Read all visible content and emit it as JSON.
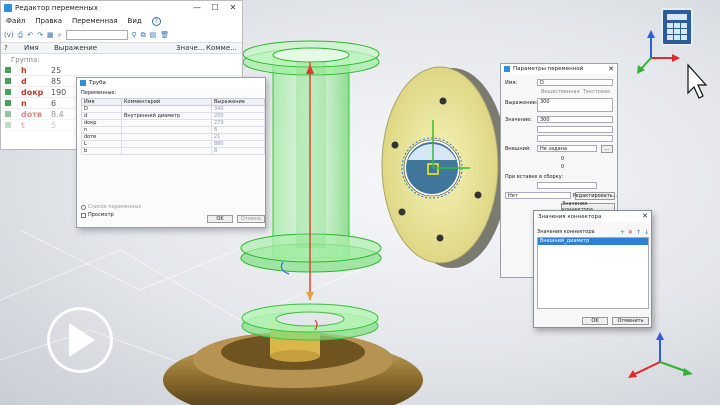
{
  "editor": {
    "title": "Редактор переменных",
    "menu": [
      "Файл",
      "Правка",
      "Переменная",
      "Вид"
    ],
    "help": "?",
    "toolbar_prefix": "(v)",
    "columns": [
      "Имя",
      "Выражение",
      "Значе...",
      "Комме..."
    ],
    "group_label": "Группа:",
    "rows": [
      {
        "name": "h",
        "value": "25"
      },
      {
        "name": "d",
        "value": "85"
      },
      {
        "name": "dокр",
        "value": "190"
      },
      {
        "name": "n",
        "value": "6"
      },
      {
        "name": "dотв",
        "value": "8.4"
      },
      {
        "name": "t",
        "value": "5"
      }
    ]
  },
  "pipe_dialog": {
    "title": "Труба",
    "section": "Переменные:",
    "columns": [
      "Имя",
      "Комментарий",
      "Выражение"
    ],
    "rows": [
      {
        "name": "D",
        "comment": "",
        "expr": "340"
      },
      {
        "name": "d",
        "comment": "Внутренний диаметр",
        "expr": "200"
      },
      {
        "name": "dокр",
        "comment": "",
        "expr": "270"
      },
      {
        "name": "n",
        "comment": "",
        "expr": "6"
      },
      {
        "name": "dотв",
        "comment": "",
        "expr": "21"
      },
      {
        "name": "L",
        "comment": "",
        "expr": "880"
      },
      {
        "name": "b",
        "comment": "",
        "expr": "8"
      }
    ],
    "list_label": "Список переменных",
    "preview_label": "Просмотр",
    "ok": "OK",
    "cancel": "Отмена"
  },
  "params_dialog": {
    "title": "Параметры переменной",
    "name_label": "Имя:",
    "name_value": "D",
    "type_real": "Вещественная",
    "type_text": "Текстовая",
    "expr_label": "Выражение:",
    "expr_value": "300",
    "value_label": "Значение:",
    "value": "300",
    "external_label": "Внешний:",
    "not_set": "Не задана",
    "insert_label": "При вставке в сборку:",
    "no": "Нет",
    "edit_button": "Редактировать...",
    "connector_values_button": "Значения коннектора..."
  },
  "connector_dialog": {
    "title": "Значения коннектора",
    "header": "Значения коннектора",
    "item": "Внешний_диаметр",
    "ok": "OK",
    "cancel": "Отменить"
  },
  "colors": {
    "accent": "#2f7fd6",
    "model_green": "#35d435",
    "flange_yellow": "#ece79a",
    "variable_red": "#c0392b"
  }
}
